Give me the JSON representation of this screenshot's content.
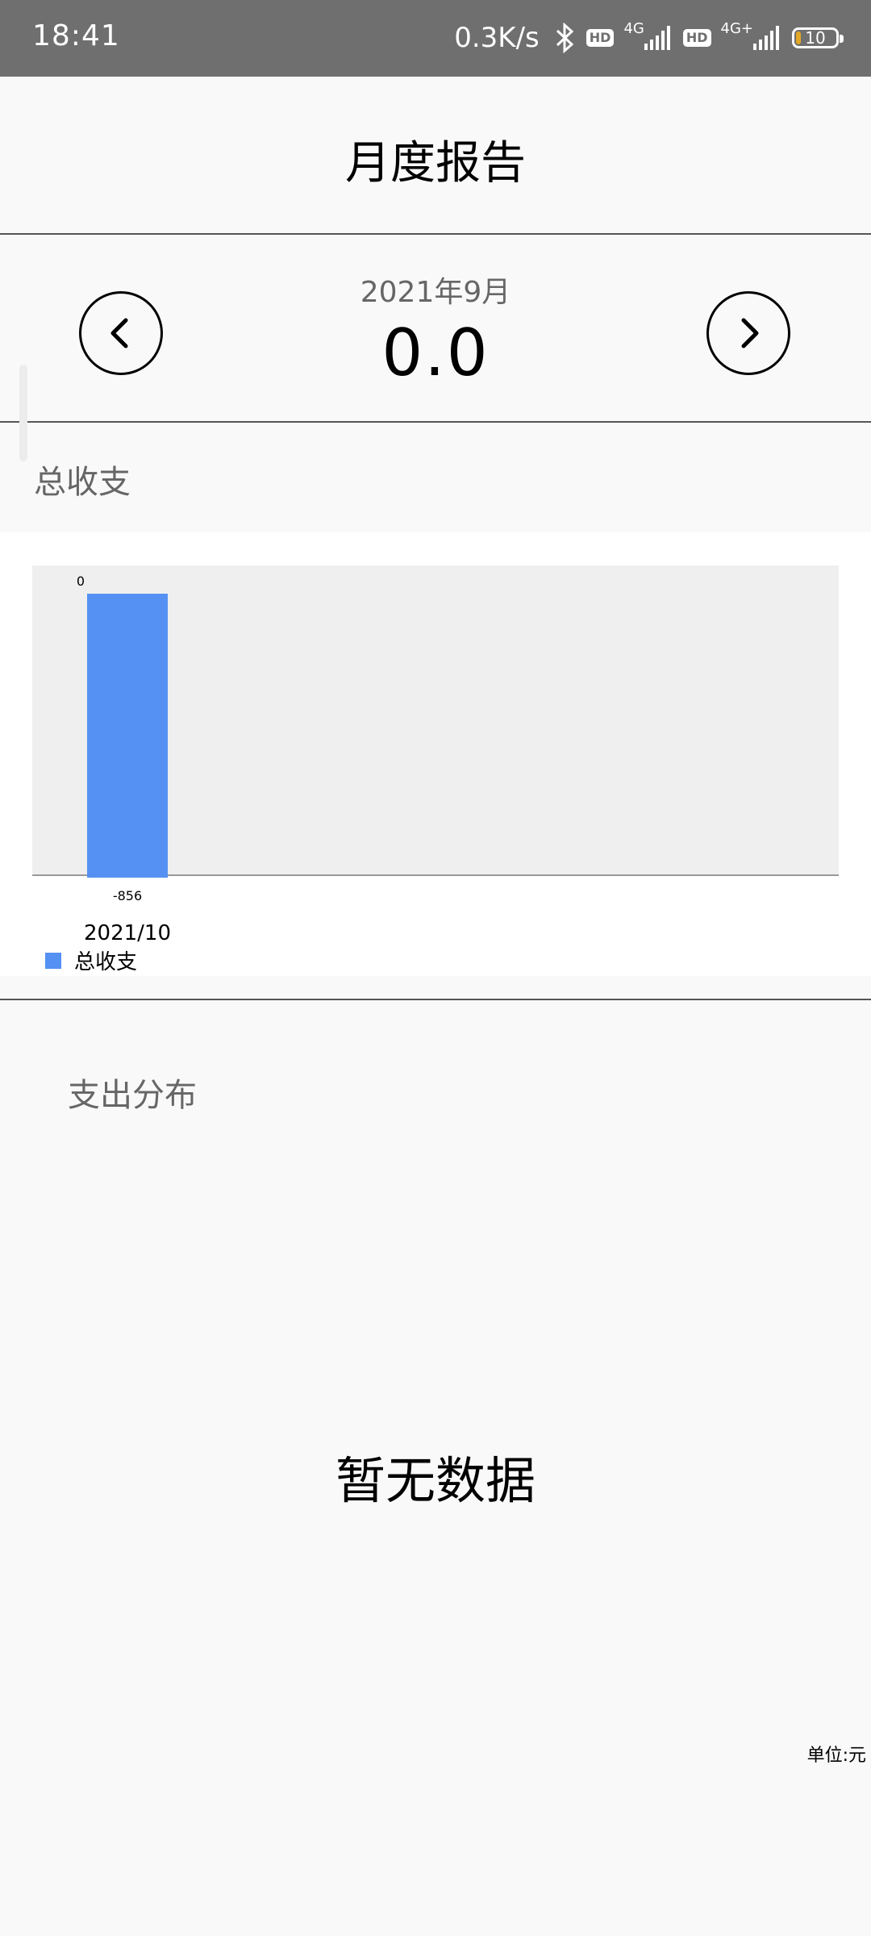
{
  "status_bar": {
    "time": "18:41",
    "net_speed": "0.3K/s",
    "bluetooth_icon": "bluetooth-icon",
    "sim1_badge": "HD",
    "sim1_network": "4G",
    "sim2_badge": "HD",
    "sim2_network": "4G+",
    "battery_level": "10"
  },
  "header": {
    "title": "月度报告"
  },
  "month_nav": {
    "month_label": "2021年9月",
    "total_value": "0.0",
    "prev_icon": "chevron-left-icon",
    "next_icon": "chevron-right-icon"
  },
  "summary_section": {
    "title": "总收支"
  },
  "chart_data": {
    "type": "bar",
    "categories": [
      "2021/10"
    ],
    "series": [
      {
        "name": "总收支",
        "values": [
          -856
        ],
        "color": "#5591f2"
      }
    ],
    "data_labels": {
      "top": "0",
      "bottom": "-856"
    },
    "ylim": [
      -856,
      0
    ],
    "legend": "bottom-left",
    "plot_background": "#efefef",
    "grid": false
  },
  "distribution_section": {
    "title": "支出分布",
    "empty_text": "暂无数据",
    "unit": "单位:元"
  }
}
